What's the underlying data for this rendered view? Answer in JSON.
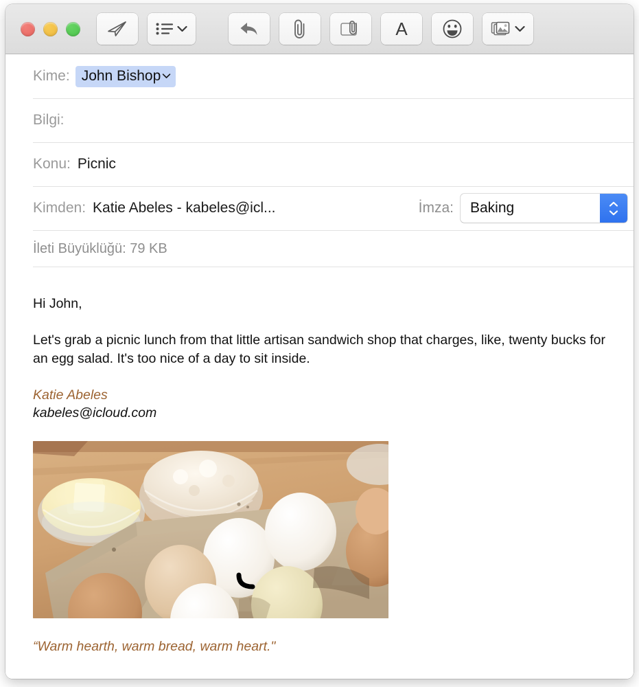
{
  "window": {
    "traffic_lights": [
      {
        "name": "close",
        "color": "#ec6a60"
      },
      {
        "name": "minimize",
        "color": "#f2bd40"
      },
      {
        "name": "zoom",
        "color": "#4cc44c"
      }
    ]
  },
  "toolbar": {
    "buttons": [
      {
        "name": "send-button",
        "icon": "paper-plane-icon",
        "label": ""
      },
      {
        "name": "header-fields-button",
        "icon": "list-icon",
        "label": "",
        "has_chevron": true
      },
      {
        "name": "reply-button",
        "icon": "reply-arrow-icon",
        "label": ""
      },
      {
        "name": "attach-button",
        "icon": "paperclip-icon",
        "label": ""
      },
      {
        "name": "markup-button",
        "icon": "markup-attachment-icon",
        "label": ""
      },
      {
        "name": "format-button",
        "icon": "letter-a-icon",
        "label": ""
      },
      {
        "name": "emoji-button",
        "icon": "smiley-face-icon",
        "label": ""
      },
      {
        "name": "photo-browser-button",
        "icon": "photos-icon",
        "label": "",
        "has_chevron": true
      }
    ]
  },
  "fields": {
    "to": {
      "label": "Kime:",
      "token": "John Bishop",
      "token_color": "#c6d7f7"
    },
    "cc": {
      "label": "Bilgi:",
      "value": ""
    },
    "subject": {
      "label": "Konu:",
      "value": "Picnic"
    },
    "from": {
      "label": "Kimden:",
      "value": "Katie Abeles - kabeles@icl..."
    },
    "signature": {
      "label": "İmza:",
      "value": "Baking",
      "accent": "#2f72ee"
    },
    "message_size": {
      "text": "İleti Büyüklüğü: 79 KB"
    }
  },
  "message": {
    "greeting": "Hi John,",
    "paragraph": "Let's grab a picnic lunch from that little artisan sandwich shop that charges, like, twenty bucks for an egg salad. It's too nice of a day to sit inside.",
    "signature_name": "Katie Abeles",
    "signature_name_color": "#9c6331",
    "signature_email": "kabeles@icloud.com",
    "image_alt": "baking-ingredients-photo",
    "quote": "“Warm hearth, warm bread, warm heart.\""
  }
}
